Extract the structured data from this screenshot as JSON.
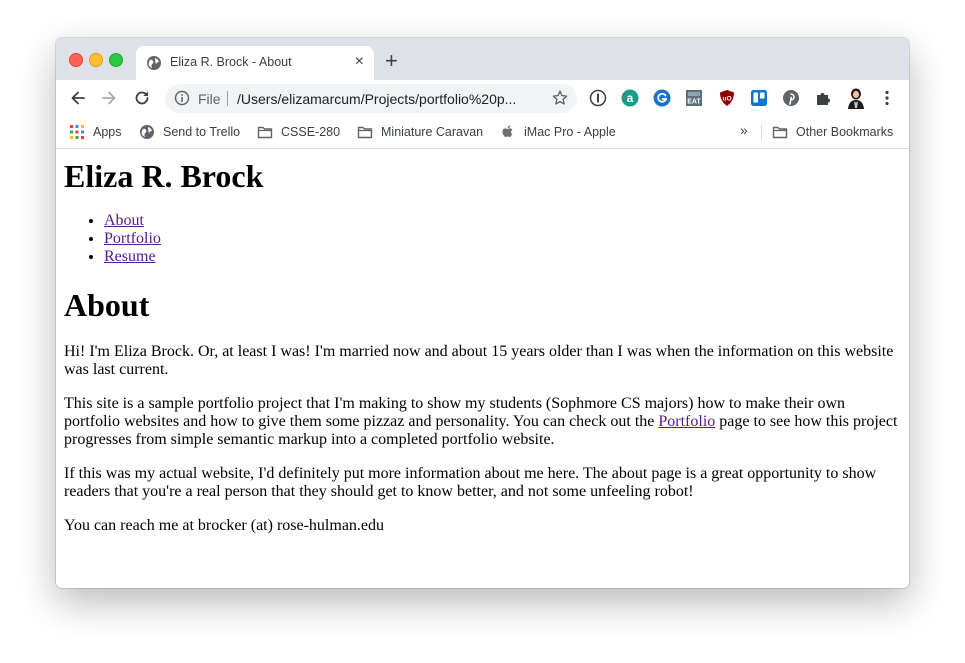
{
  "browser": {
    "tab_title": "Eliza R. Brock - About",
    "tab_close": "×",
    "new_tab": "+",
    "url_scheme": "File",
    "url": "/Users/elizamarcum/Projects/portfolio%20p...",
    "bookmarks": [
      {
        "label": "Apps",
        "icon": "apps-grid-icon"
      },
      {
        "label": "Send to Trello",
        "icon": "globe-icon"
      },
      {
        "label": "CSSE-280",
        "icon": "folder-icon"
      },
      {
        "label": "Miniature Caravan",
        "icon": "folder-icon"
      },
      {
        "label": "iMac Pro - Apple",
        "icon": "apple-icon"
      }
    ],
    "overflow": "»",
    "other_bookmarks": "Other Bookmarks",
    "extensions": [
      "1password-icon",
      "amazon-assistant-icon",
      "grammarly-icon",
      "slow-eat-icon",
      "ublock-icon",
      "trello-icon",
      "pinterest-icon",
      "extensions-puzzle-icon",
      "profile-avatar-icon",
      "menu-kebab-icon"
    ]
  },
  "page": {
    "site_title": "Eliza R. Brock",
    "nav": [
      "About",
      "Portfolio",
      "Resume"
    ],
    "heading": "About",
    "p1": "Hi! I'm Eliza Brock. Or, at least I was! I'm married now and about 15 years older than I was when the information on this website was last current.",
    "p2_before": "This site is a sample portfolio project that I'm making to show my students (Sophmore CS majors) how to make their own portfolio websites and how to give them some pizzaz and personality. You can check out the ",
    "p2_link": "Portfolio",
    "p2_after": " page to see how this project progresses from simple semantic markup into a completed portfolio website.",
    "p3": "If this was my actual website, I'd definitely put more information about me here. The about page is a great opportunity to show readers that you're a real person that they should get to know better, and not some unfeeling robot!",
    "p4": "You can reach me at brocker (at) rose-hulman.edu"
  },
  "colors": {
    "visited_link": "#551a8b",
    "tabstrip": "#dee1e6",
    "omnibox": "#f1f3f4"
  }
}
